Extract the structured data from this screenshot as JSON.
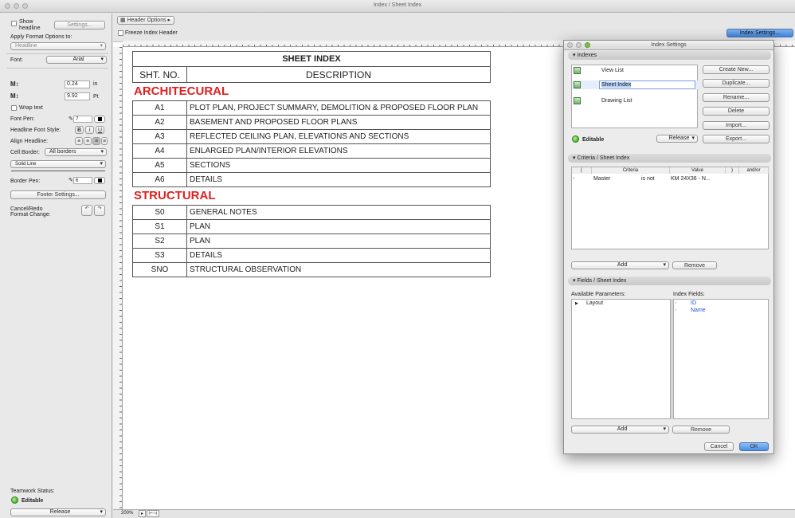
{
  "window": {
    "title": "Index /  Sheet Index"
  },
  "left_panel": {
    "show_headline_label": "Show headline",
    "settings_button": "Settings...",
    "apply_format_label": "Apply Format Options to:",
    "apply_format_value": "Headline",
    "font_label": "Font:",
    "font_value": "Arial",
    "size1_value": "0.24",
    "size1_unit": "in",
    "size2_value": "9.92",
    "size2_unit": "Pt",
    "wrap_text_label": "Wrap text",
    "font_pen_label": "Font Pen:",
    "font_pen_value": "7",
    "headline_font_style_label": "Headline Font Style:",
    "style_bold": "B",
    "style_italic": "I",
    "style_underline": "U",
    "align_headline_label": "Align Headline:",
    "cell_border_label": "Cell Border:",
    "cell_border_value": "All borders",
    "line_type_value": "Solid Line",
    "border_pen_label": "Border Pen:",
    "border_pen_value": "6",
    "footer_settings_button": "Footer Settings...",
    "cancel_redo_label": "Cancel/Redo",
    "format_change_label": "Format Change:",
    "teamwork_status_label": "Teamwork Status:",
    "editable_label": "Editable",
    "release_value": "Release"
  },
  "toolbar": {
    "header_options_label": "Header Options",
    "freeze_index_header_label": "Freeze Index Header",
    "index_settings_button": "Index Settings..."
  },
  "statusbar": {
    "zoom": "200%"
  },
  "sheet": {
    "title": "SHEET INDEX",
    "col_sht_no": "SHT. NO.",
    "col_description": "DESCRIPTION",
    "sections": [
      {
        "name": "ARCHITECURAL",
        "rows": [
          {
            "no": "A1",
            "desc": "PLOT PLAN, PROJECT SUMMARY, DEMOLITION & PROPOSED FLOOR PLAN"
          },
          {
            "no": "A2",
            "desc": "BASEMENT AND PROPOSED FLOOR PLANS"
          },
          {
            "no": "A3",
            "desc": "REFLECTED CEILING PLAN, ELEVATIONS AND SECTIONS"
          },
          {
            "no": "A4",
            "desc": "ENLARGED PLAN/INTERIOR ELEVATIONS"
          },
          {
            "no": "A5",
            "desc": "SECTIONS"
          },
          {
            "no": "A6",
            "desc": "DETAILS"
          }
        ]
      },
      {
        "name": "STRUCTURAL",
        "rows": [
          {
            "no": "S0",
            "desc": "GENERAL NOTES"
          },
          {
            "no": "S1",
            "desc": "PLAN"
          },
          {
            "no": "S2",
            "desc": "PLAN"
          },
          {
            "no": "S3",
            "desc": "DETAILS"
          },
          {
            "no": "SNO",
            "desc": "STRUCTURAL OBSERVATION"
          }
        ]
      }
    ]
  },
  "dialog": {
    "title": "Index Settings",
    "indexes_header": "Indexes",
    "index_list": [
      "View List",
      "Sheet Index",
      "Drawing List"
    ],
    "create_new": "Create New...",
    "duplicate": "Duplicate...",
    "rename": "Rename...",
    "delete": "Delete",
    "import": "Import...",
    "export": "Export...",
    "editable_label": "Editable",
    "release_value": "Release",
    "criteria_header": "Criteria /  Sheet Index",
    "criteria_cols": [
      "(",
      "Criteria",
      "Value",
      ")",
      "and/or"
    ],
    "criteria_row": {
      "criteria": "Master",
      "op": "is not",
      "value": "KM 24X36 - N..."
    },
    "add": "Add",
    "remove": "Remove",
    "fields_header": "Fields /  Sheet Index",
    "available_params_label": "Available Parameters:",
    "index_fields_label": "Index Fields:",
    "available_params": [
      "Layout"
    ],
    "index_fields": [
      "ID",
      "Name"
    ],
    "cancel": "Cancel",
    "ok": "OK"
  }
}
